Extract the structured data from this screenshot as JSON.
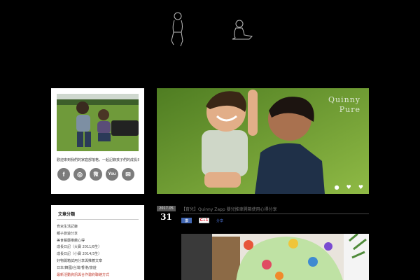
{
  "banner": {
    "caption_line1": "Quinny",
    "caption_line2": "Pure"
  },
  "profile": {
    "intro": "歡迎來到我們的家庭部落格，一起記錄孩子們的成長日常"
  },
  "social": [
    {
      "icon": "facebook-icon",
      "glyph": "f"
    },
    {
      "icon": "instagram-icon",
      "glyph": "◎"
    },
    {
      "icon": "weibo-icon",
      "glyph": "微"
    },
    {
      "icon": "youtube-icon",
      "glyph": "You"
    },
    {
      "icon": "email-icon",
      "glyph": "✉"
    }
  ],
  "categories": {
    "title": "文章分類",
    "items": [
      "育兒生活記錄",
      "親子旅遊分享",
      "美食餐廳推薦心得",
      "成長日記（大寶 2011/8生）",
      "成長日記（小寶 2014/3生）",
      "好物開箱試用分享與推薦文章",
      "日本/韓國/台灣/香港/旅遊",
      "最新活動資訊與合作邀約聯絡方式"
    ]
  },
  "post": {
    "month": "2017.05",
    "day": "31",
    "title": "【育兒】Quinny Zapp 嬰兒推車開箱使用心得分享",
    "like": "讚",
    "gplus": "G+1",
    "share": "分享"
  }
}
